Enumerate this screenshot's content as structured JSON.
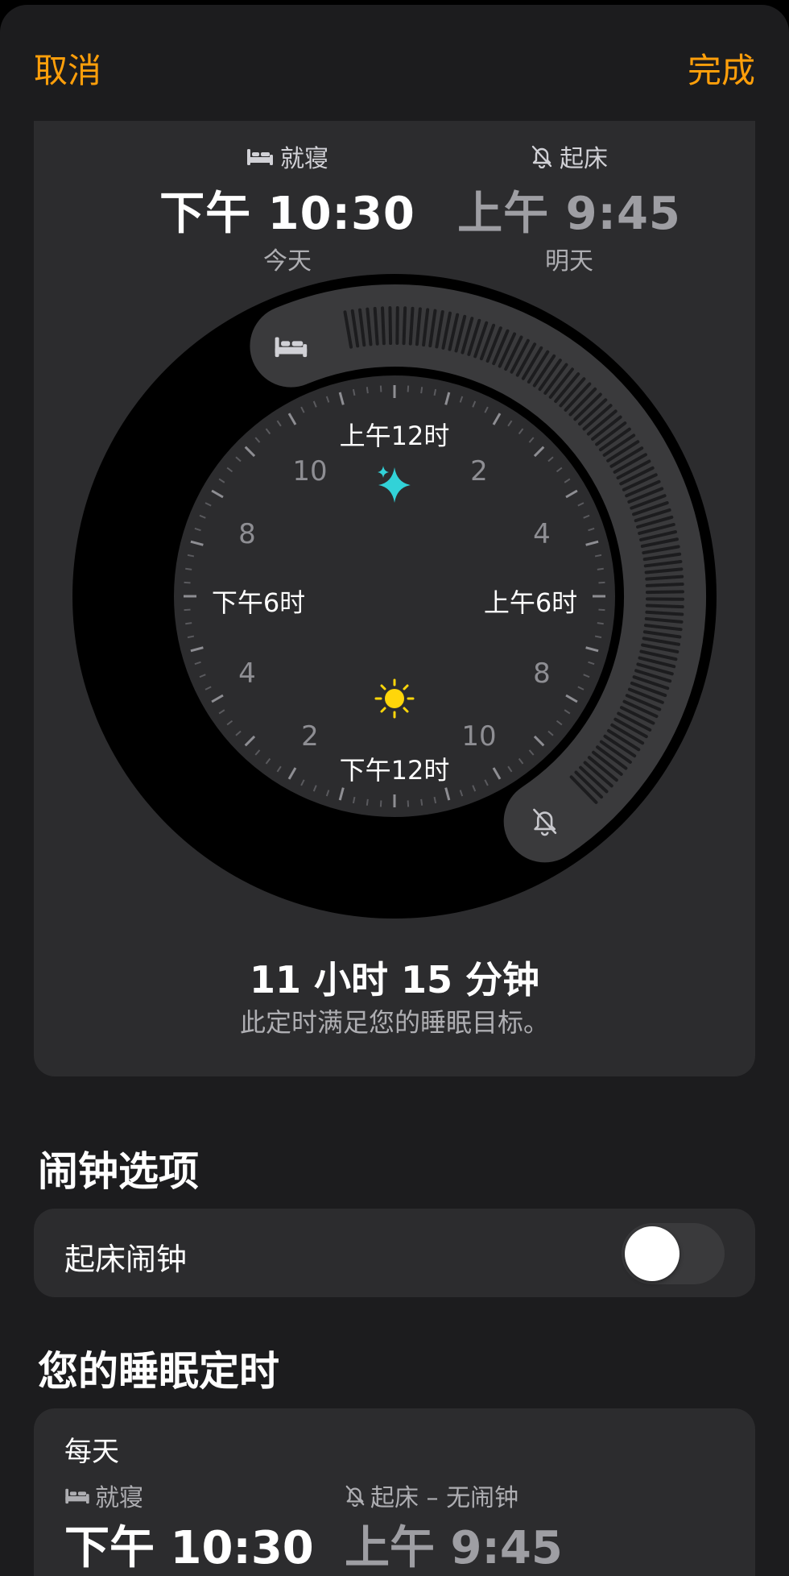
{
  "nav": {
    "cancel": "取消",
    "done": "完成"
  },
  "bedtime": {
    "label": "就寝",
    "time": "下午 10:30",
    "day": "今天"
  },
  "wake": {
    "label": "起床",
    "time": "上午 9:45",
    "day": "明天"
  },
  "dial": {
    "top": "上午12时",
    "bottom": "下午12时",
    "right": "上午6时",
    "left": "下午6时",
    "n10a": "10",
    "n2a": "2",
    "n8a": "8",
    "n4a": "4",
    "n4b": "4",
    "n8b": "8",
    "n2b": "2",
    "n10b": "10",
    "bed_hour": 22.5,
    "wake_hour": 9.75
  },
  "duration": "11 小时 15 分钟",
  "goal_text": "此定时满足您的睡眠目标。",
  "alarm_section": {
    "title": "闹钟选项",
    "alarm_label": "起床闹钟",
    "enabled": false
  },
  "schedule_section": {
    "title": "您的睡眠定时",
    "frequency": "每天",
    "bed_label": "就寝",
    "bed_time": "下午 10:30",
    "wake_label": "起床 – 无闹钟",
    "wake_time": "上午 9:45"
  },
  "colors": {
    "accent": "#ff9f0a",
    "night": "#32d2d8",
    "sun": "#ffd60a"
  },
  "icons": [
    "bed-icon",
    "bell-slash-icon",
    "sparkle-icon",
    "sun-icon"
  ]
}
